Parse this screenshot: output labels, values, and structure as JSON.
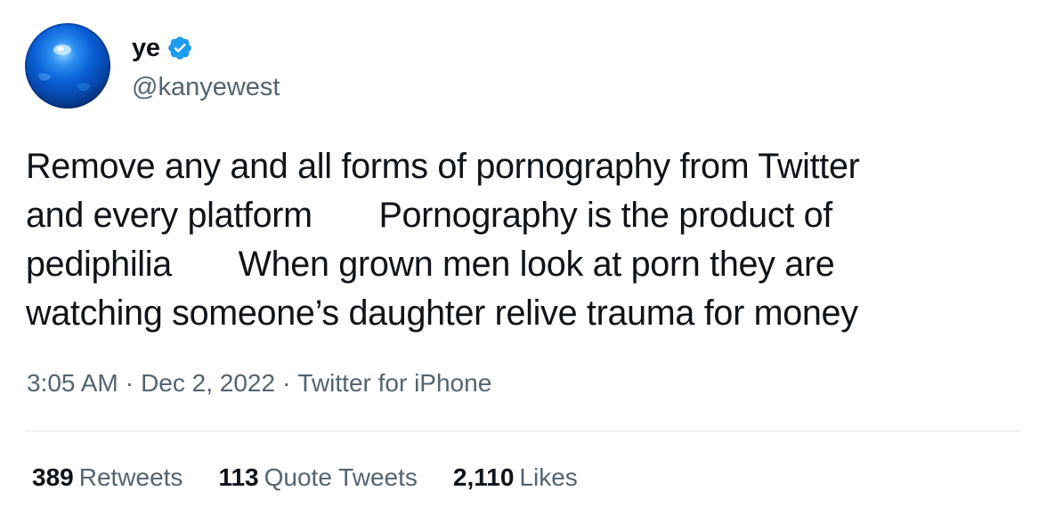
{
  "tweet": {
    "author": {
      "display_name": "ye",
      "handle": "@kanyewest",
      "verified": true,
      "avatar_icon": "blue-globe-avatar"
    },
    "text_lines": [
      "Remove any and all forms of pornography from Twitter",
      "and every platform       Pornography is the product of",
      "pediphilia       When grown men look at porn they are",
      "watching someone’s daughter relive trauma for money"
    ],
    "time": "3:05 AM",
    "date": "Dec 2, 2022",
    "source": "Twitter for iPhone",
    "separator": "·",
    "stats": {
      "retweets": {
        "count": "389",
        "label": "Retweets"
      },
      "quote_tweets": {
        "count": "113",
        "label": "Quote Tweets"
      },
      "likes": {
        "count": "2,110",
        "label": "Likes"
      }
    }
  },
  "colors": {
    "primary_text": "#0f1419",
    "secondary_text": "#536471",
    "verified_badge": "#1d9bf0",
    "divider": "#e5e9ec"
  }
}
